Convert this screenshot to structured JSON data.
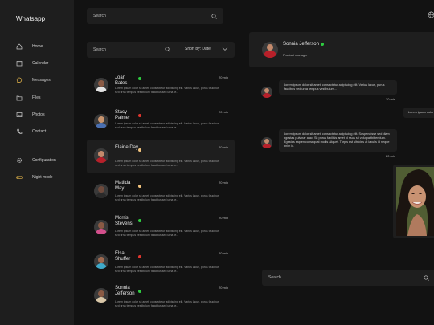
{
  "app": {
    "title": "Whatsapp"
  },
  "sidebar": {
    "items": [
      {
        "label": "Home",
        "icon": "home-icon"
      },
      {
        "label": "Calendar",
        "icon": "calendar-icon"
      },
      {
        "label": "Messages",
        "icon": "messages-icon"
      },
      {
        "label": "Files",
        "icon": "files-icon"
      },
      {
        "label": "Photos",
        "icon": "photos-icon"
      },
      {
        "label": "Contact",
        "icon": "phone-icon"
      },
      {
        "label": "Configuration",
        "icon": "gear-icon"
      },
      {
        "label": "Night mode",
        "icon": "toggle-icon"
      }
    ]
  },
  "top_search": {
    "placeholder": "Search"
  },
  "list_search": {
    "placeholder": "Search",
    "sort_label": "Short by: Date"
  },
  "conversations": [
    {
      "name": "Joan Bates",
      "status": "online",
      "time": "20 min",
      "preview": "Lorem ipsum dolor sit amet, consectetur adipiscing elit. Varius lacus, purus faucibus sed urna tempus vestibulum faucibus sed urna te..."
    },
    {
      "name": "Stacy Palmer",
      "status": "busy",
      "time": "20 min",
      "preview": "Lorem ipsum dolor sit amet, consectetur adipiscing elit. Varius lacus, purus faucibus sed urna tempus vestibulum faucibus sed urna te..."
    },
    {
      "name": "Elaine Day",
      "status": "away",
      "time": "20 min",
      "preview": "Lorem ipsum dolor sit amet, consectetur adipiscing elit. Varius lacus, purus faucibus sed urna tempus vestibulum faucibus sed urna te..."
    },
    {
      "name": "Matilda May",
      "status": "away",
      "time": "20 min",
      "preview": "Lorem ipsum dolor sit amet, consectetur adipiscing elit. Varius lacus, purus faucibus sed urna tempus vestibulum faucibus sed urna te..."
    },
    {
      "name": "Morris Stevens",
      "status": "online",
      "time": "20 min",
      "preview": "Lorem ipsum dolor sit amet, consectetur adipiscing elit. Varius lacus, purus faucibus sed urna tempus vestibulum faucibus sed urna te..."
    },
    {
      "name": "Elsa Shuffer",
      "status": "busy",
      "time": "20 min",
      "preview": "Lorem ipsum dolor sit amet, consectetur adipiscing elit. Varius lacus, purus faucibus sed urna tempus vestibulum faucibus sed urna te..."
    },
    {
      "name": "Sonnia Jefferson",
      "status": "online",
      "time": "20 min",
      "preview": "Lorem ipsum dolor sit amet, consectetur adipiscing elit. Varius lacus, purus faucibus sed urna tempus vestibulum faucibus sed urna te..."
    }
  ],
  "chat": {
    "name": "Sonnia Jefferson",
    "role": "Product manager",
    "messages": [
      {
        "text": "Lorem ipsum dolor sit amet, consectetur adipiscing elit. Varius lacus, purus faucibus sed urna tempus vestibulum...",
        "time": "20 min"
      },
      {
        "text": "Lorem ipsum dolor sit"
      },
      {
        "text": "Lorem ipsum dolor sit amet, consectetur adipiscing elit. Suspendisse sed diam egestas pulvinar a ac. Sit purus facilisis amet id risus sit volutpat bibendum. Egestas sapien consequat mollis aliquet. Turpis est ultricies at iaculis id neque enim id.",
        "time": "20 min"
      }
    ],
    "input_placeholder": "Search"
  },
  "colors": {
    "online": "#2ecc40",
    "busy": "#e0362e",
    "away": "#f1c27d",
    "background": "#121212",
    "panel": "#1e1e1e"
  }
}
